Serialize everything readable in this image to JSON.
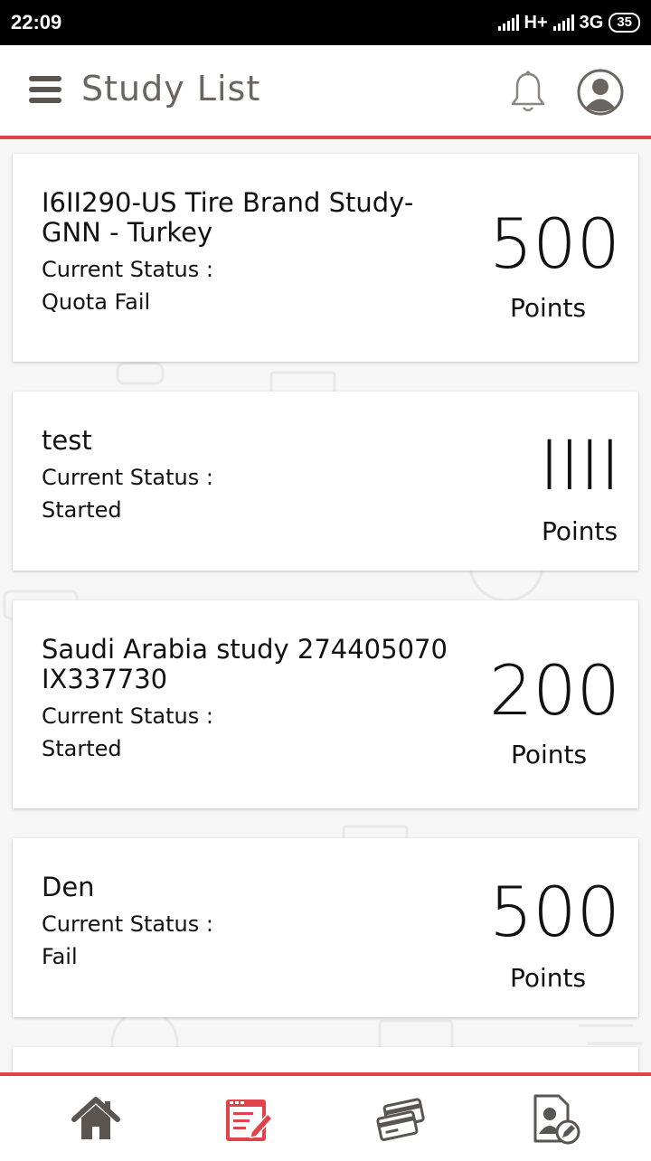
{
  "status_bar": {
    "time": "22:09",
    "network_1": "H+",
    "network_2": "3G",
    "battery": "35"
  },
  "header": {
    "title": "Study List",
    "icons": [
      "menu-icon",
      "bell-icon",
      "profile-avatar-icon"
    ]
  },
  "studies": [
    {
      "name": "I6II290-US Tire Brand Study-GNN - Turkey",
      "status_label": "Current Status :",
      "status": "Quota Fail",
      "points": "500",
      "points_label": "Points"
    },
    {
      "name": "test",
      "status_label": "Current Status :",
      "status": "Started",
      "points": "IIII",
      "points_label": "Points"
    },
    {
      "name": "Saudi Arabia study 274405070 IX337730",
      "status_label": "Current Status :",
      "status": "Started",
      "points": "200",
      "points_label": "Points"
    },
    {
      "name": "Den",
      "status_label": "Current Status :",
      "status": "Fail",
      "points": "500",
      "points_label": "Points"
    }
  ],
  "bottom_nav": {
    "items": [
      "home-icon",
      "study-list-icon",
      "rewards-cards-icon",
      "profile-edit-icon"
    ],
    "active": "study-list-icon"
  },
  "colors": {
    "accent": "#e0444a",
    "header_text": "#6a6560",
    "icon_gray": "#5a5550"
  }
}
